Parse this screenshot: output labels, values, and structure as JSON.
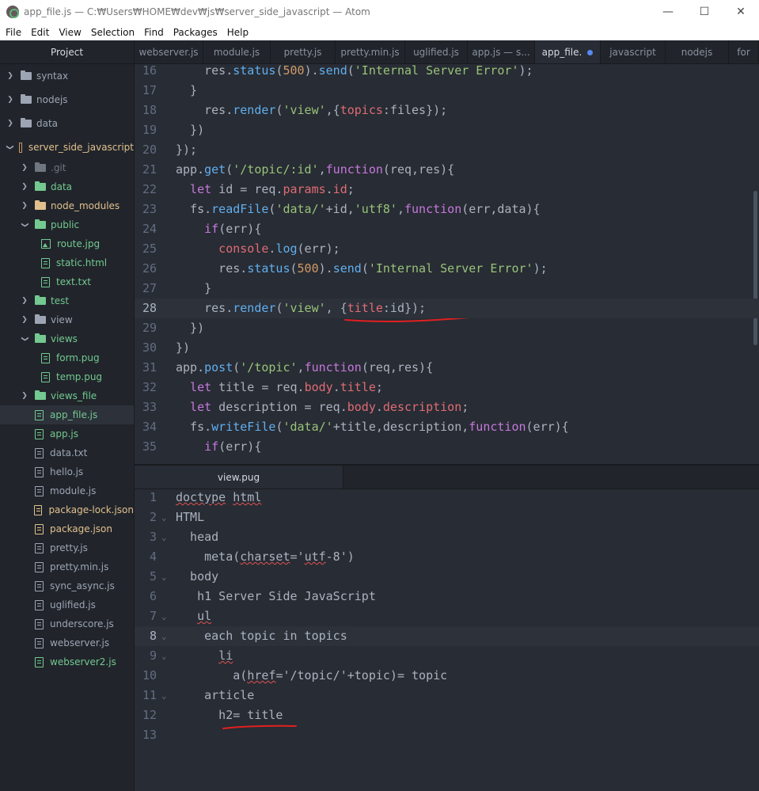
{
  "window": {
    "title": "app_file.js — C:₩Users₩HOME₩dev₩js₩server_side_javascript — Atom",
    "minimize": "—",
    "maximize": "☐",
    "close": "✕"
  },
  "menu": [
    "File",
    "Edit",
    "View",
    "Selection",
    "Find",
    "Packages",
    "Help"
  ],
  "sidebar": {
    "header": "Project",
    "items": [
      {
        "label": "syntax",
        "kind": "folder",
        "color": "default",
        "chevron": "›",
        "depth": 0
      },
      {
        "label": "nodejs",
        "kind": "folder",
        "color": "default",
        "chevron": "›",
        "depth": 0
      },
      {
        "label": "data",
        "kind": "folder",
        "color": "default",
        "chevron": "›",
        "depth": 0
      },
      {
        "label": "server_side_javascript",
        "kind": "repo",
        "color": "orange-text",
        "chevron": "⌄",
        "depth": 0
      },
      {
        "label": ".git",
        "kind": "folder",
        "color": "gray",
        "chevron": "›",
        "depth": 1
      },
      {
        "label": "data",
        "kind": "folder",
        "color": "green",
        "chevron": "›",
        "depth": 1
      },
      {
        "label": "node_modules",
        "kind": "folder",
        "color": "orange",
        "chevron": "›",
        "depth": 1
      },
      {
        "label": "public",
        "kind": "folder",
        "color": "green",
        "chevron": "⌄",
        "depth": 1
      },
      {
        "label": "route.jpg",
        "kind": "image",
        "color": "green",
        "chevron": "",
        "depth": 2
      },
      {
        "label": "static.html",
        "kind": "file",
        "color": "green",
        "chevron": "",
        "depth": 2
      },
      {
        "label": "text.txt",
        "kind": "file",
        "color": "green",
        "chevron": "",
        "depth": 2
      },
      {
        "label": "test",
        "kind": "folder",
        "color": "green",
        "chevron": "›",
        "depth": 1
      },
      {
        "label": "view",
        "kind": "folder",
        "color": "default",
        "chevron": "›",
        "depth": 1
      },
      {
        "label": "views",
        "kind": "folder",
        "color": "green",
        "chevron": "⌄",
        "depth": 1
      },
      {
        "label": "form.pug",
        "kind": "file",
        "color": "green",
        "chevron": "",
        "depth": 2
      },
      {
        "label": "temp.pug",
        "kind": "file",
        "color": "green",
        "chevron": "",
        "depth": 2
      },
      {
        "label": "views_file",
        "kind": "folder",
        "color": "green",
        "chevron": "›",
        "depth": 1
      },
      {
        "label": "app_file.js",
        "kind": "file",
        "color": "green",
        "chevron": "",
        "depth": 1,
        "selected": true
      },
      {
        "label": "app.js",
        "kind": "file",
        "color": "green",
        "chevron": "",
        "depth": 1
      },
      {
        "label": "data.txt",
        "kind": "file",
        "color": "default",
        "chevron": "",
        "depth": 1
      },
      {
        "label": "hello.js",
        "kind": "file",
        "color": "default",
        "chevron": "",
        "depth": 1
      },
      {
        "label": "module.js",
        "kind": "file",
        "color": "default",
        "chevron": "",
        "depth": 1
      },
      {
        "label": "package-lock.json",
        "kind": "file",
        "color": "orange",
        "chevron": "",
        "depth": 1
      },
      {
        "label": "package.json",
        "kind": "file",
        "color": "orange",
        "chevron": "",
        "depth": 1
      },
      {
        "label": "pretty.js",
        "kind": "file",
        "color": "default",
        "chevron": "",
        "depth": 1
      },
      {
        "label": "pretty.min.js",
        "kind": "file",
        "color": "default",
        "chevron": "",
        "depth": 1
      },
      {
        "label": "sync_async.js",
        "kind": "file",
        "color": "default",
        "chevron": "",
        "depth": 1
      },
      {
        "label": "uglified.js",
        "kind": "file",
        "color": "default",
        "chevron": "",
        "depth": 1
      },
      {
        "label": "underscore.js",
        "kind": "file",
        "color": "default",
        "chevron": "",
        "depth": 1
      },
      {
        "label": "webserver.js",
        "kind": "file",
        "color": "default",
        "chevron": "",
        "depth": 1
      },
      {
        "label": "webserver2.js",
        "kind": "file",
        "color": "green",
        "chevron": "",
        "depth": 1
      }
    ]
  },
  "top_tabs": [
    {
      "label": "webserver.js"
    },
    {
      "label": "module.js"
    },
    {
      "label": "pretty.js"
    },
    {
      "label": "pretty.min.js"
    },
    {
      "label": "uglified.js"
    },
    {
      "label": "app.js — s..."
    },
    {
      "label": "app_file.",
      "active": true,
      "modified": true
    },
    {
      "label": "javascript"
    },
    {
      "label": "nodejs"
    },
    {
      "label": "for"
    }
  ],
  "bottom_tabs": [
    {
      "label": "view.pug",
      "active": true
    }
  ],
  "top_editor": {
    "cursor_line": 28,
    "lines": [
      {
        "n": "16",
        "fold": "",
        "t": [
          [
            "p",
            "    res."
          ],
          [
            "f",
            "status"
          ],
          [
            "p",
            "("
          ],
          [
            "n",
            "500"
          ],
          [
            "p",
            ")."
          ],
          [
            "f",
            "send"
          ],
          [
            "p",
            "("
          ],
          [
            "s",
            "'Internal Server Error'"
          ],
          [
            "p",
            ");"
          ]
        ]
      },
      {
        "n": "17",
        "fold": "",
        "t": [
          [
            "p",
            "  }"
          ]
        ]
      },
      {
        "n": "18",
        "fold": "",
        "t": [
          [
            "p",
            "    res."
          ],
          [
            "f",
            "render"
          ],
          [
            "p",
            "("
          ],
          [
            "s",
            "'view'"
          ],
          [
            "p",
            ",{"
          ],
          [
            "r",
            "topics"
          ],
          [
            "p",
            ":files});"
          ]
        ]
      },
      {
        "n": "19",
        "fold": "",
        "t": [
          [
            "p",
            "  })"
          ]
        ]
      },
      {
        "n": "20",
        "fold": "",
        "t": [
          [
            "p",
            "});"
          ]
        ]
      },
      {
        "n": "21",
        "fold": "",
        "t": [
          [
            "p",
            "app."
          ],
          [
            "f",
            "get"
          ],
          [
            "p",
            "("
          ],
          [
            "s",
            "'/topic/:id'"
          ],
          [
            "p",
            ","
          ],
          [
            "k",
            "function"
          ],
          [
            "p",
            "(req,res){"
          ]
        ]
      },
      {
        "n": "22",
        "fold": "",
        "t": [
          [
            "k",
            "  let"
          ],
          [
            "p",
            " id = req."
          ],
          [
            "r",
            "params"
          ],
          [
            "p",
            "."
          ],
          [
            "r",
            "id"
          ],
          [
            "p",
            ";"
          ]
        ]
      },
      {
        "n": "23",
        "fold": "",
        "t": [
          [
            "p",
            "  fs."
          ],
          [
            "f",
            "readFile"
          ],
          [
            "p",
            "("
          ],
          [
            "s",
            "'data/'"
          ],
          [
            "p",
            "+id,"
          ],
          [
            "s",
            "'utf8'"
          ],
          [
            "p",
            ","
          ],
          [
            "k",
            "function"
          ],
          [
            "p",
            "(err,data){"
          ]
        ]
      },
      {
        "n": "24",
        "fold": "",
        "t": [
          [
            "k",
            "    if"
          ],
          [
            "p",
            "(err){"
          ]
        ]
      },
      {
        "n": "25",
        "fold": "",
        "t": [
          [
            "r",
            "      console"
          ],
          [
            "p",
            "."
          ],
          [
            "f",
            "log"
          ],
          [
            "p",
            "(err);"
          ]
        ]
      },
      {
        "n": "26",
        "fold": "",
        "t": [
          [
            "p",
            "      res."
          ],
          [
            "f",
            "status"
          ],
          [
            "p",
            "("
          ],
          [
            "n",
            "500"
          ],
          [
            "p",
            ")."
          ],
          [
            "f",
            "send"
          ],
          [
            "p",
            "("
          ],
          [
            "s",
            "'Internal Server Error'"
          ],
          [
            "p",
            ");"
          ]
        ]
      },
      {
        "n": "27",
        "fold": "",
        "t": [
          [
            "p",
            "    }"
          ]
        ]
      },
      {
        "n": "28",
        "fold": "",
        "t": [
          [
            "p",
            "    res."
          ],
          [
            "f",
            "render"
          ],
          [
            "p",
            "("
          ],
          [
            "s",
            "'view'"
          ],
          [
            "p",
            ", {"
          ],
          [
            "r",
            "title"
          ],
          [
            "p",
            ":id});"
          ]
        ]
      },
      {
        "n": "29",
        "fold": "",
        "t": [
          [
            "p",
            "  })"
          ]
        ]
      },
      {
        "n": "30",
        "fold": "",
        "t": [
          [
            "p",
            "})"
          ]
        ]
      },
      {
        "n": "31",
        "fold": "",
        "t": [
          [
            "p",
            "app."
          ],
          [
            "f",
            "post"
          ],
          [
            "p",
            "("
          ],
          [
            "s",
            "'/topic'"
          ],
          [
            "p",
            ","
          ],
          [
            "k",
            "function"
          ],
          [
            "p",
            "(req,res){"
          ]
        ]
      },
      {
        "n": "32",
        "fold": "",
        "t": [
          [
            "k",
            "  let"
          ],
          [
            "p",
            " title = req."
          ],
          [
            "r",
            "body"
          ],
          [
            "p",
            "."
          ],
          [
            "r",
            "title"
          ],
          [
            "p",
            ";"
          ]
        ]
      },
      {
        "n": "33",
        "fold": "",
        "t": [
          [
            "k",
            "  let"
          ],
          [
            "p",
            " description = req."
          ],
          [
            "r",
            "body"
          ],
          [
            "p",
            "."
          ],
          [
            "r",
            "description"
          ],
          [
            "p",
            ";"
          ]
        ]
      },
      {
        "n": "34",
        "fold": "",
        "t": [
          [
            "p",
            "  fs."
          ],
          [
            "f",
            "writeFile"
          ],
          [
            "p",
            "("
          ],
          [
            "s",
            "'data/'"
          ],
          [
            "p",
            "+title,description,"
          ],
          [
            "k",
            "function"
          ],
          [
            "p",
            "(err){"
          ]
        ]
      },
      {
        "n": "35",
        "fold": "",
        "t": [
          [
            "k",
            "    if"
          ],
          [
            "p",
            "(err){"
          ]
        ]
      }
    ]
  },
  "bottom_editor": {
    "cursor_line": 8,
    "lines": [
      {
        "n": "1",
        "fold": "",
        "t": [
          [
            "q",
            "doctype"
          ],
          [
            "p",
            " "
          ],
          [
            "q",
            "html"
          ]
        ]
      },
      {
        "n": "2",
        "fold": "⌄",
        "t": [
          [
            "p",
            "HTML"
          ]
        ]
      },
      {
        "n": "3",
        "fold": "⌄",
        "t": [
          [
            "p",
            "  head"
          ]
        ]
      },
      {
        "n": "4",
        "fold": "",
        "t": [
          [
            "p",
            "    meta("
          ],
          [
            "q",
            "charset"
          ],
          [
            "p",
            "='"
          ],
          [
            "q",
            "utf"
          ],
          [
            "p",
            "-8')"
          ]
        ]
      },
      {
        "n": "5",
        "fold": "⌄",
        "t": [
          [
            "p",
            "  body"
          ]
        ]
      },
      {
        "n": "6",
        "fold": "",
        "t": [
          [
            "p",
            "   h1 Server Side JavaScript"
          ]
        ]
      },
      {
        "n": "7",
        "fold": "⌄",
        "t": [
          [
            "p",
            "   "
          ],
          [
            "q",
            "ul"
          ]
        ]
      },
      {
        "n": "8",
        "fold": "⌄",
        "t": [
          [
            "p",
            "    each topic in topics"
          ]
        ]
      },
      {
        "n": "9",
        "fold": "⌄",
        "t": [
          [
            "p",
            "      "
          ],
          [
            "q",
            "li"
          ]
        ]
      },
      {
        "n": "10",
        "fold": "",
        "t": [
          [
            "p",
            "        a("
          ],
          [
            "q",
            "href"
          ],
          [
            "p",
            "='/topic/'+topic)= topic"
          ]
        ]
      },
      {
        "n": "11",
        "fold": "⌄",
        "t": [
          [
            "p",
            "    article"
          ]
        ]
      },
      {
        "n": "12",
        "fold": "",
        "t": [
          [
            "p",
            "      h2= title"
          ]
        ]
      },
      {
        "n": "13",
        "fold": "",
        "t": [
          [
            "p",
            ""
          ]
        ]
      }
    ]
  },
  "colors": {
    "accent_blue": "#568af2",
    "vcs_green": "#73c990",
    "vcs_orange": "#e2c08d",
    "annotation_red": "#e02020"
  }
}
